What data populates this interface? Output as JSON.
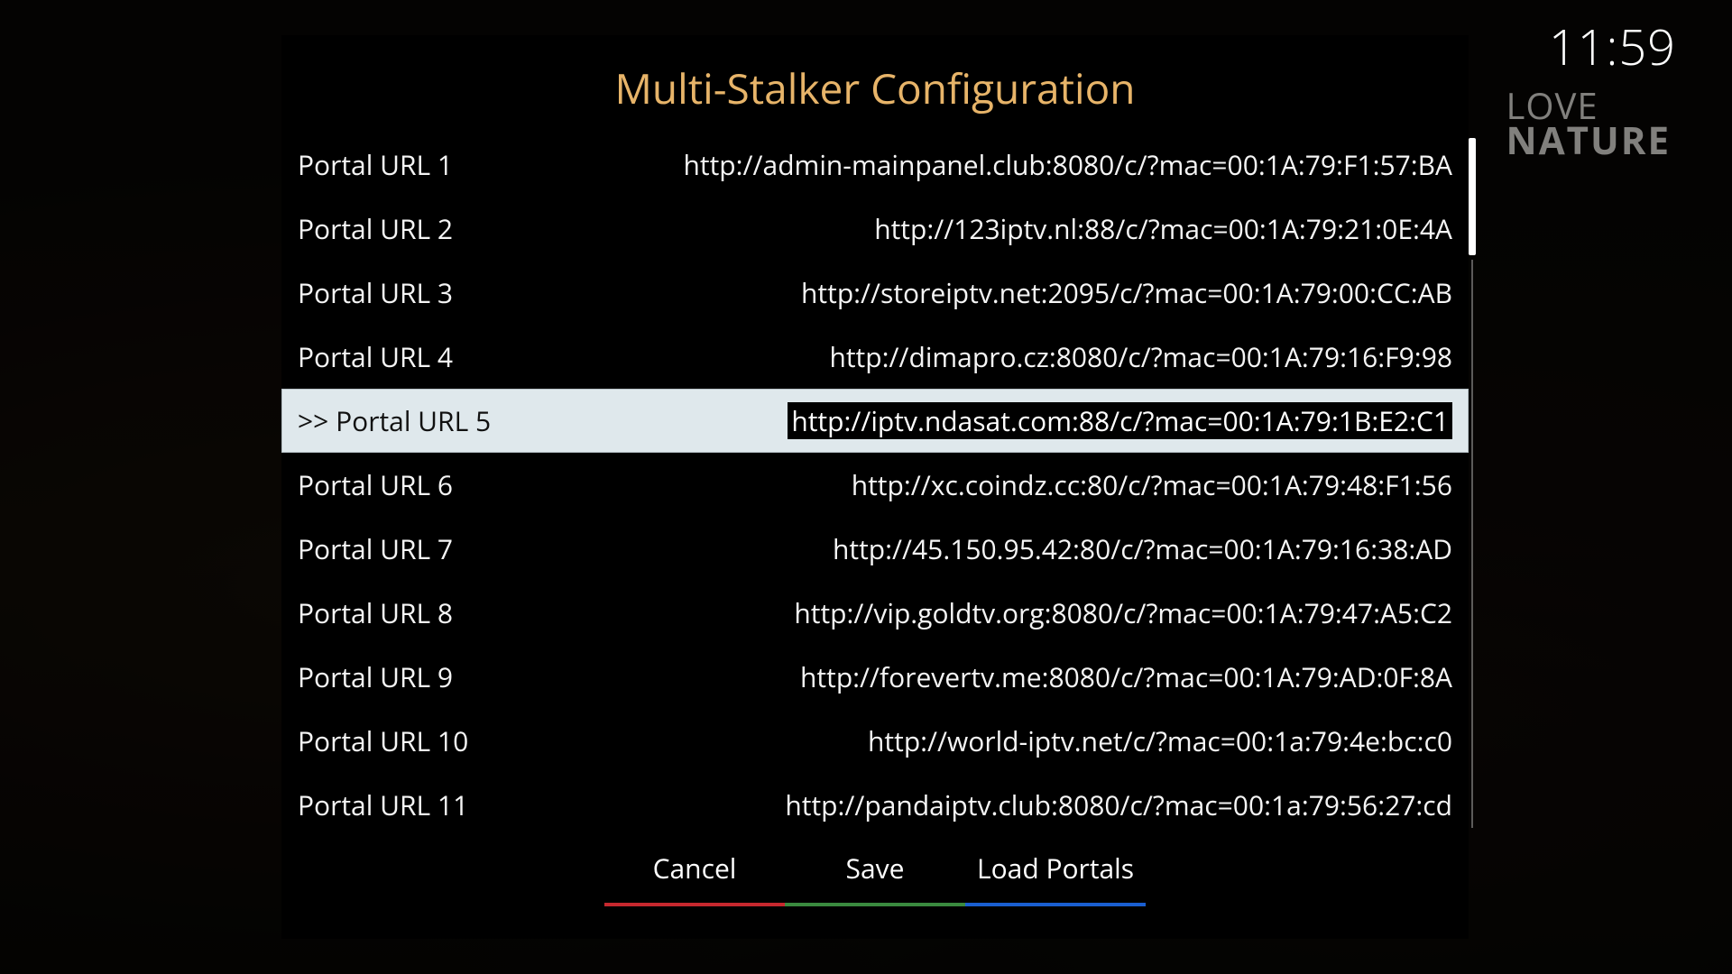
{
  "clock": "11:59",
  "background_logo": {
    "line1": "Love",
    "line2": "NATURE"
  },
  "dialog": {
    "title": "Multi-Stalker Configuration",
    "selected_index": 4,
    "selected_prefix": ">> ",
    "rows": [
      {
        "label": "Portal URL 1",
        "value": "http://admin-mainpanel.club:8080/c/?mac=00:1A:79:F1:57:BA"
      },
      {
        "label": "Portal URL 2",
        "value": "http://123iptv.nl:88/c/?mac=00:1A:79:21:0E:4A"
      },
      {
        "label": "Portal URL 3",
        "value": "http://storeiptv.net:2095/c/?mac=00:1A:79:00:CC:AB"
      },
      {
        "label": "Portal URL 4",
        "value": "http://dimapro.cz:8080/c/?mac=00:1A:79:16:F9:98"
      },
      {
        "label": "Portal URL 5",
        "value": "http://iptv.ndasat.com:88/c/?mac=00:1A:79:1B:E2:C1"
      },
      {
        "label": "Portal URL 6",
        "value": "http://xc.coindz.cc:80/c/?mac=00:1A:79:48:F1:56"
      },
      {
        "label": "Portal URL 7",
        "value": "http://45.150.95.42:80/c/?mac=00:1A:79:16:38:AD"
      },
      {
        "label": "Portal URL 8",
        "value": "http://vip.goldtv.org:8080/c/?mac=00:1A:79:47:A5:C2"
      },
      {
        "label": "Portal URL 9",
        "value": "http://forevertv.me:8080/c/?mac=00:1A:79:AD:0F:8A"
      },
      {
        "label": "Portal URL 10",
        "value": "http://world-iptv.net/c/?mac=00:1a:79:4e:bc:c0"
      },
      {
        "label": "Portal URL 11",
        "value": "http://pandaiptv.club:8080/c/?mac=00:1a:79:56:27:cd"
      }
    ],
    "buttons": {
      "cancel": "Cancel",
      "save": "Save",
      "load_portals": "Load Portals"
    }
  }
}
